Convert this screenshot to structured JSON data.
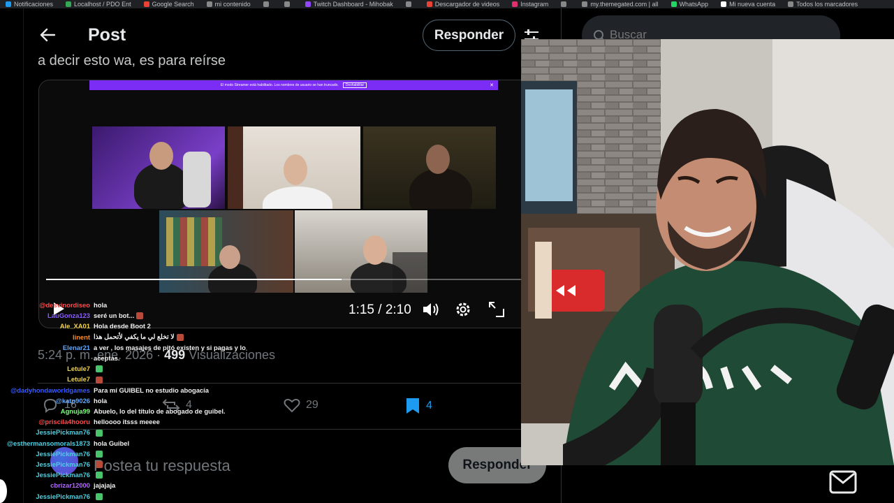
{
  "bookmarks": [
    {
      "label": "Notificaciones",
      "color": "#1d9bf0"
    },
    {
      "label": "Localhost / PDO Ent",
      "color": "#34a853"
    },
    {
      "label": "Google Search",
      "color": "#ea4335"
    },
    {
      "label": "mi contenido",
      "color": "#888"
    },
    {
      "label": "",
      "color": "#888"
    },
    {
      "label": "",
      "color": "#888"
    },
    {
      "label": "Twitch Dashboard - Mihobak",
      "color": "#9146ff"
    },
    {
      "label": "",
      "color": "#888"
    },
    {
      "label": "Descargador de videos",
      "color": "#ea4335"
    },
    {
      "label": "Instagram",
      "color": "#e1306c"
    },
    {
      "label": "",
      "color": "#888"
    },
    {
      "label": "my.themegated.com | all",
      "color": "#888"
    },
    {
      "label": "WhatsApp",
      "color": "#25d366"
    },
    {
      "label": "Mi nueva cuenta",
      "color": "#fff"
    },
    {
      "label": "Todos los marcadores",
      "color": "#888"
    }
  ],
  "header": {
    "title": "Post",
    "reply_button": "Responder"
  },
  "tweet": {
    "text": "a decir esto wa, es para reírse"
  },
  "video": {
    "banner_text": "El modo Streamer está habilitado. Los nombres de usuario se han truncado.",
    "banner_button": "Deshabilitar",
    "time": "1:15 / 2:10",
    "progress": 0.58
  },
  "meta": {
    "time": "5:24 p. m.",
    "date": "ene. 2026",
    "views_count": "499",
    "views_label": "Visualizaciones"
  },
  "actions": {
    "replies": "16",
    "reposts": "4",
    "likes": "29",
    "bookmarks": "4",
    "bookmark_color": "#1d9bf0"
  },
  "reply_box": {
    "placeholder": "Postea tu respuesta",
    "button": "Responder"
  },
  "search": {
    "placeholder": "Buscar"
  },
  "chat": [
    {
      "user": "@desvinordiseo",
      "color": "#ff4d4d",
      "msg": "hola",
      "emoji": false
    },
    {
      "user": "LauGonza123",
      "color": "#8a5cff",
      "msg": "seré un bot...",
      "emoji": true
    },
    {
      "user": "Ale_XA01",
      "color": "#f2d44a",
      "msg": "Hola desde Boot 2",
      "emoji": false
    },
    {
      "user": "linent",
      "color": "#ff8c1a",
      "msg": "لا تخلع لي ما يكفي لأتحمل هذا",
      "emoji": true
    },
    {
      "user": "Elenar21",
      "color": "#5ea8ff",
      "msg": "a ver , los masajes de pitó existen y si pagas y lo",
      "emoji": false
    },
    {
      "user": "",
      "color": "#5ea8ff",
      "msg": "aceptas.",
      "emoji": false
    },
    {
      "user": "Letule7",
      "color": "#f2d44a",
      "msg": "",
      "emoji": true
    },
    {
      "user": "Letule7",
      "color": "#f2d44a",
      "msg": "",
      "emoji": true
    },
    {
      "user": "@dadyhondaworldgames",
      "color": "#3a5cff",
      "msg": "Para mí GUIBEL no estudio abogacía",
      "emoji": false
    },
    {
      "user": "@katp9026",
      "color": "#5ea8ff",
      "msg": "hola",
      "emoji": false
    },
    {
      "user": "Agnuja99",
      "color": "#7fff7f",
      "msg": "Abuelo, lo del título de abogado de guibel.",
      "emoji": false
    },
    {
      "user": "@priscila4hooru",
      "color": "#ff4d4d",
      "msg": "helloooo itsss meeee",
      "emoji": false
    },
    {
      "user": "JessiePickman76",
      "color": "#4dd0e1",
      "msg": "",
      "emoji": true
    },
    {
      "user": "@esthermansomorals1873",
      "color": "#4dd0e1",
      "msg": "hola Guibel",
      "emoji": false
    },
    {
      "user": "JessiePickman76",
      "color": "#4dd0e1",
      "msg": "",
      "emoji": true
    },
    {
      "user": "JessiePickman76",
      "color": "#4dd0e1",
      "msg": "",
      "emoji": true
    },
    {
      "user": "JessiePickman76",
      "color": "#4dd0e1",
      "msg": "",
      "emoji": true
    },
    {
      "user": "cbrizar12000",
      "color": "#b36bff",
      "msg": "jajajaja",
      "emoji": false
    },
    {
      "user": "JessiePickman76",
      "color": "#4dd0e1",
      "msg": "",
      "emoji": true
    }
  ]
}
